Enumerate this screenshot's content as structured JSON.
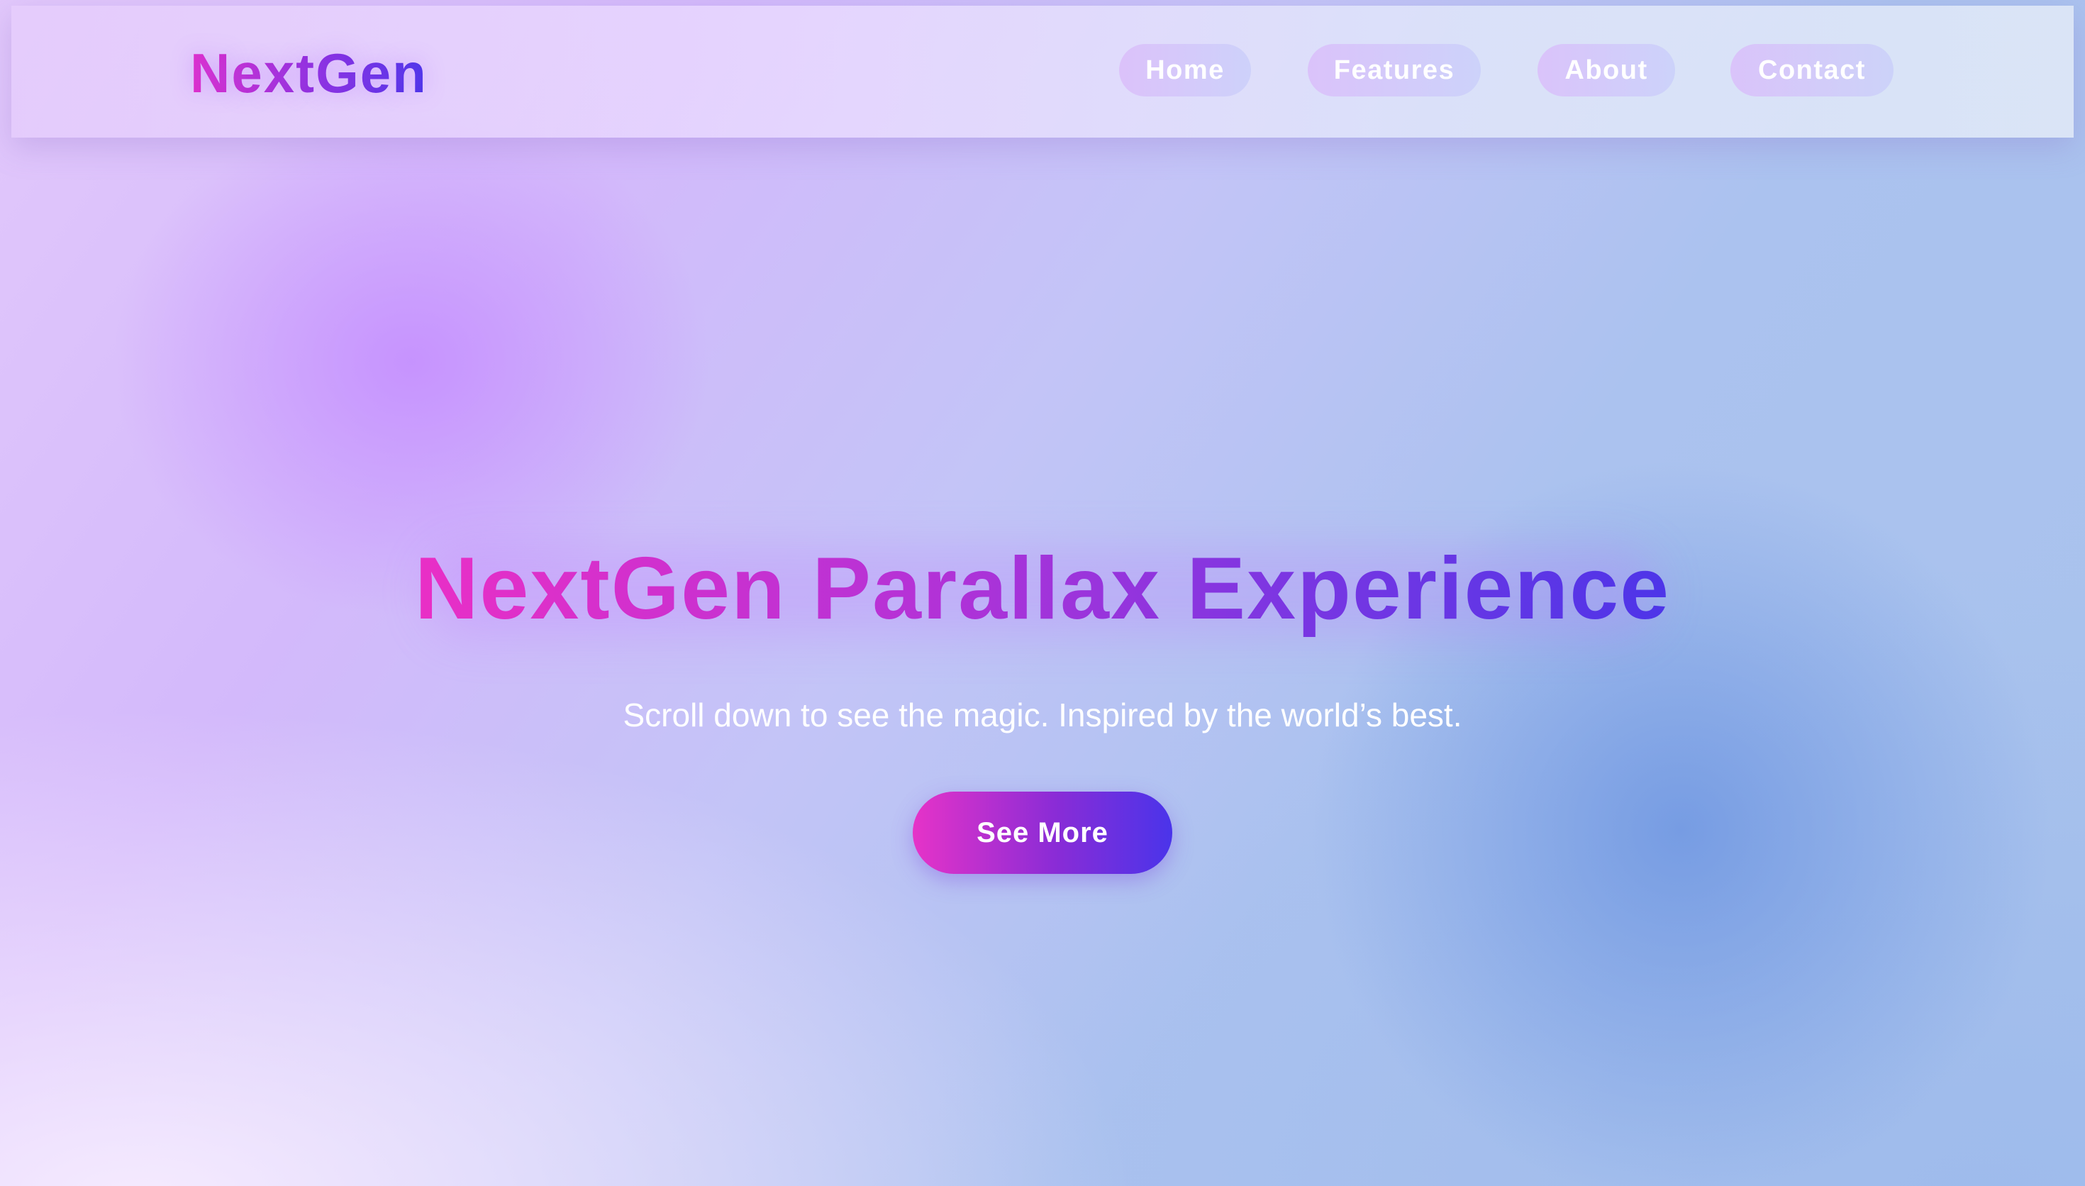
{
  "header": {
    "logo": "NextGen",
    "nav": [
      {
        "label": "Home"
      },
      {
        "label": "Features"
      },
      {
        "label": "About"
      },
      {
        "label": "Contact"
      }
    ]
  },
  "hero": {
    "title": "NextGen Parallax Experience",
    "subtitle": "Scroll down to see the magic. Inspired by the world’s best.",
    "cta_label": "See More"
  },
  "colors": {
    "accent_start": "#e633c8",
    "accent_end": "#4a34ea",
    "text_light": "#ffffff"
  }
}
